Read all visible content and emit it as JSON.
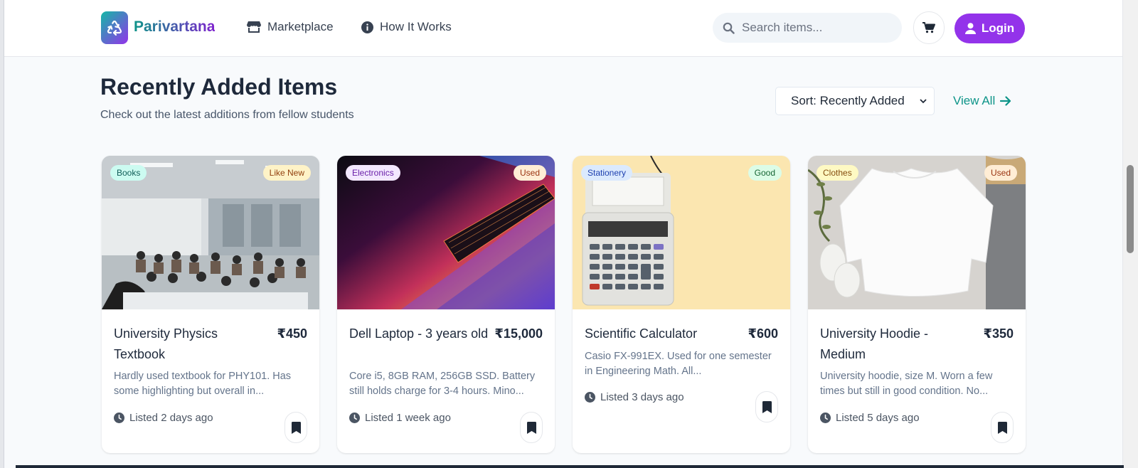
{
  "nav": {
    "brand": "Parivartana",
    "links": [
      {
        "label": "Marketplace",
        "icon": "store-icon"
      },
      {
        "label": "How It Works",
        "icon": "info-icon"
      }
    ],
    "search_placeholder": "Search items...",
    "login_label": "Login"
  },
  "section": {
    "title": "Recently Added Items",
    "subtitle": "Check out the latest additions from fellow students",
    "sort_value": "Sort: Recently Added",
    "view_all": "View All"
  },
  "cards": [
    {
      "category": "Books",
      "condition": "Like New",
      "title": "University Physics Textbook",
      "price": "₹450",
      "description": "Hardly used textbook for PHY101. Has some highlighting but overall in...",
      "listed": "Listed 2 days ago",
      "image": "classroom-photo"
    },
    {
      "category": "Electronics",
      "condition": "Used",
      "title": "Dell Laptop - 3 years old",
      "price": "₹15,000",
      "description": "Core i5, 8GB RAM, 256GB SSD. Battery still holds charge for 3-4 hours. Mino...",
      "listed": "Listed 1 week ago",
      "image": "laptop-photo"
    },
    {
      "category": "Stationery",
      "condition": "Good",
      "title": "Scientific Calculator",
      "price": "₹600",
      "description": "Casio FX-991EX. Used for one semester in Engineering Math. All...",
      "listed": "Listed 3 days ago",
      "image": "calculator-photo"
    },
    {
      "category": "Clothes",
      "condition": "Used",
      "title": "University Hoodie - Medium",
      "price": "₹350",
      "description": "University hoodie, size M. Worn a few times but still in good condition. No...",
      "listed": "Listed 5 days ago",
      "image": "hoodie-photo"
    }
  ],
  "colors": {
    "accent": "#9333ea",
    "teal": "#0d9488",
    "background": "#f8fafc"
  }
}
